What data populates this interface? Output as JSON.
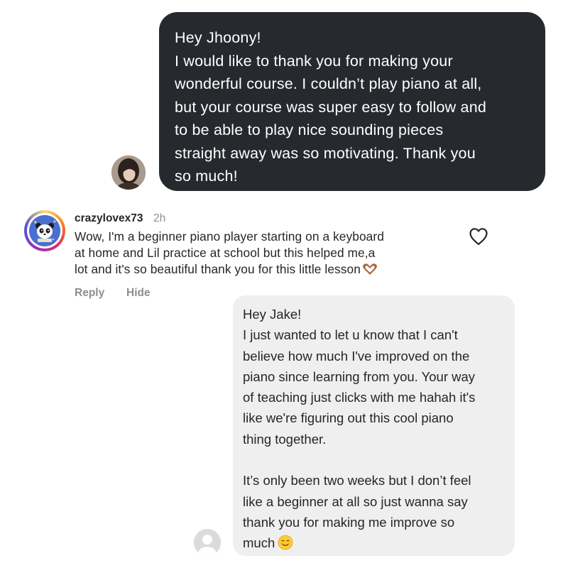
{
  "top_message": {
    "lines": [
      "Hey Jhoony!",
      "I would like to thank you for making your",
      "wonderful course. I couldn’t play piano at all,",
      "but your course was super easy to follow and",
      "to be able to play nice sounding pieces",
      "straight away was so motivating. Thank you",
      "so much!"
    ]
  },
  "comment": {
    "username": "crazylovex73",
    "timestamp": "2h",
    "lines": [
      "Wow, I'm a beginner piano player starting on a keyboard",
      "at home and Lil practice at school but this helped me,a",
      "lot and it's so beautiful thank you for this little lesson"
    ],
    "reply_label": "Reply",
    "hide_label": "Hide",
    "end_emoji": "heart-hands-emoji"
  },
  "bottom_message": {
    "lines": [
      "Hey Jake!",
      "I just wanted to let u know that I can't",
      "believe how much I've improved on the",
      "piano since learning from you. Your way",
      "of teaching just clicks with me hahah it's",
      "like we're figuring out this cool piano",
      "thing together.",
      "",
      "It’s only been two weeks but I don’t feel",
      "like a beginner at all so just wanna say",
      "thank you for making me improve so",
      "much"
    ],
    "end_emoji": "smiling-face-emoji"
  },
  "colors": {
    "dark_bubble": "#262a2f",
    "light_bubble": "#efefef",
    "secondary_text": "#8e8e8e",
    "primary_text": "#262626"
  }
}
